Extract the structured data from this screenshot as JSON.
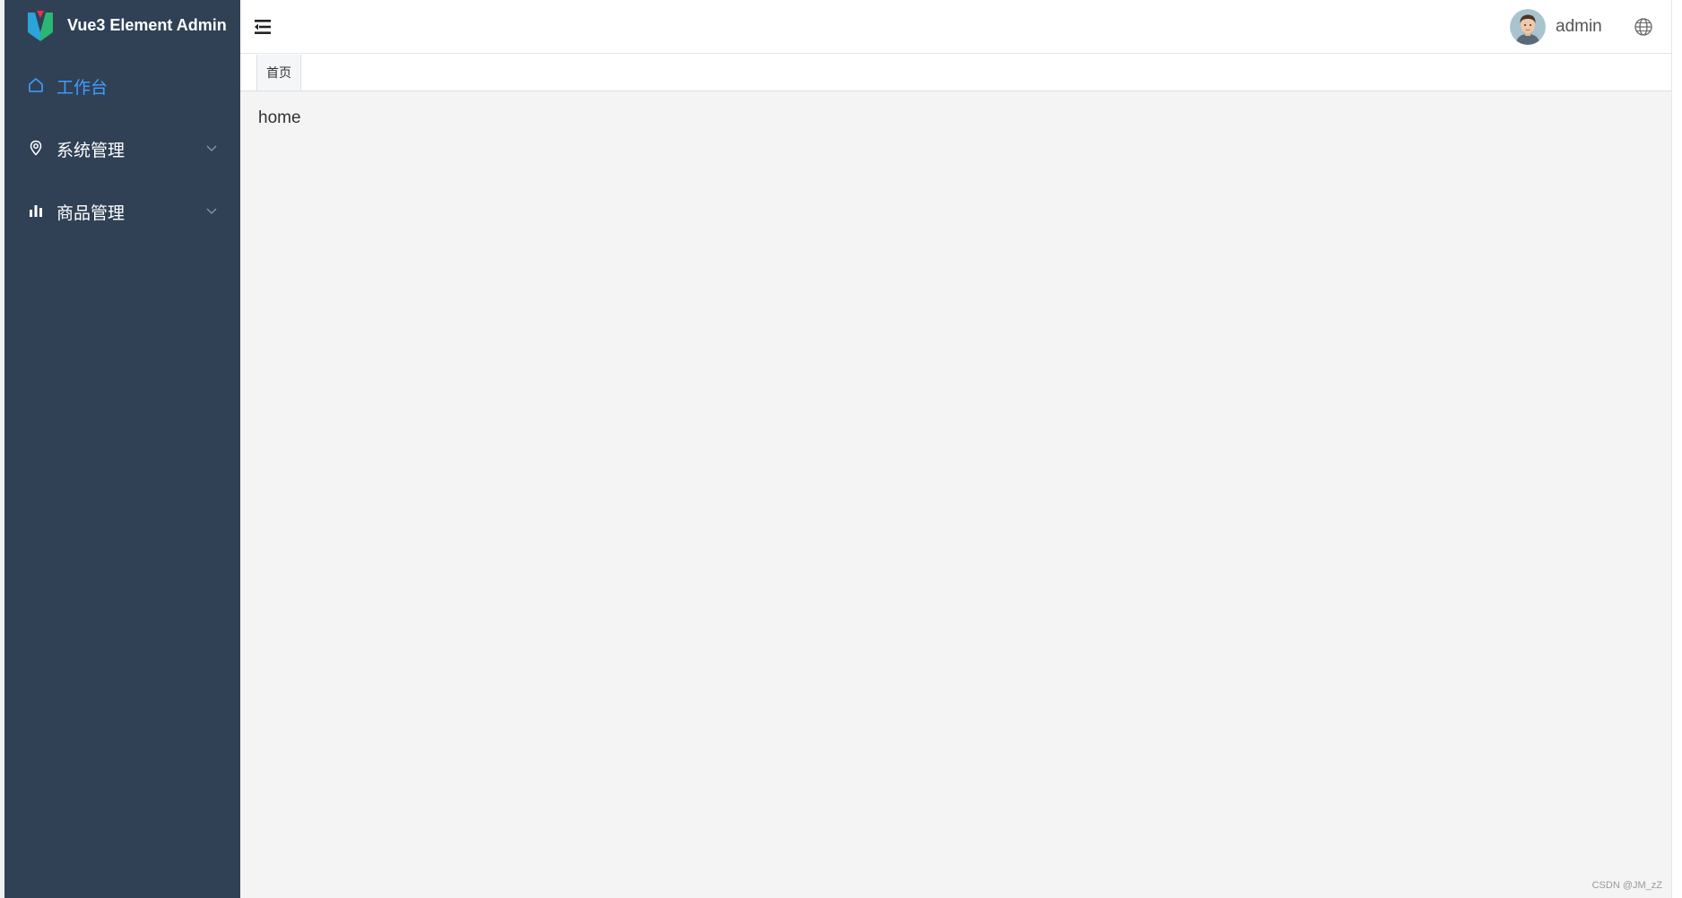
{
  "app": {
    "title": "Vue3 Element Admin"
  },
  "colors": {
    "sidebar_bg": "#304156",
    "active": "#409eff",
    "menu_text": "#ffffff",
    "main_bg": "#f4f4f5"
  },
  "sidebar": {
    "items": [
      {
        "label": "工作台",
        "icon": "home-icon",
        "active": true
      },
      {
        "label": "系统管理",
        "icon": "location-icon",
        "expandable": true
      },
      {
        "label": "商品管理",
        "icon": "bar-chart-icon",
        "expandable": true
      }
    ]
  },
  "header": {
    "username": "admin",
    "icons": [
      "menu-fold-icon",
      "avatar",
      "globe-icon"
    ]
  },
  "tags": [
    {
      "label": "首页"
    }
  ],
  "main": {
    "content": "home"
  },
  "watermark": "CSDN @JM_zZ"
}
